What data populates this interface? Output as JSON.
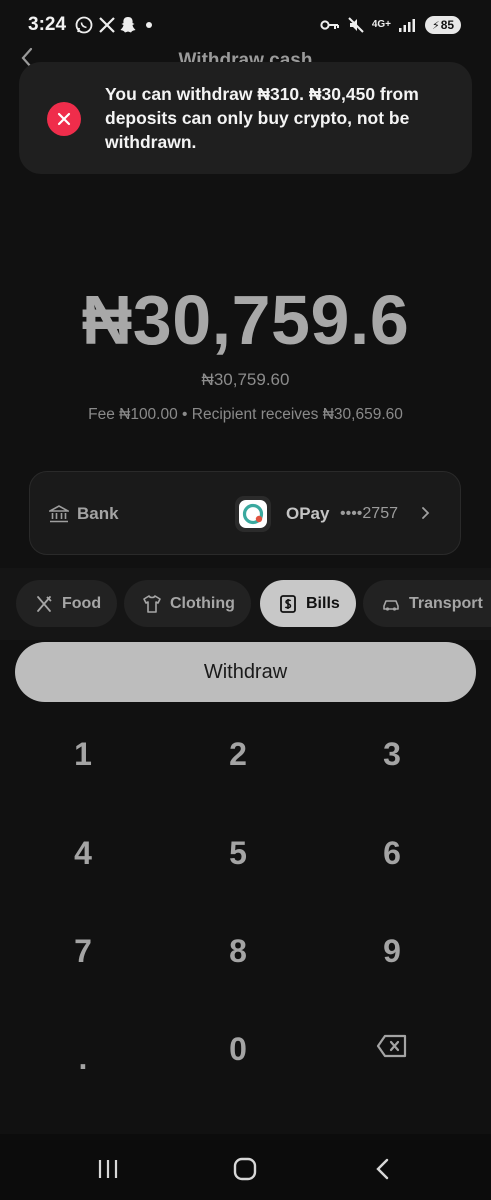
{
  "status": {
    "time": "3:24",
    "network": "4G+",
    "battery": "85"
  },
  "header": {
    "title": "Withdraw cash"
  },
  "toast": {
    "message": "You can withdraw ₦310. ₦30,450 from deposits can only buy crypto, not be withdrawn."
  },
  "amount": {
    "main": "₦30,759.6",
    "sub": "₦30,759.60",
    "fee_line": "Fee ₦100.00 • Recipient receives ₦30,659.60"
  },
  "bank": {
    "label": "Bank",
    "provider": "OPay",
    "account": "••••2757"
  },
  "chips": [
    {
      "label": "Food",
      "icon": "fork-knife-icon"
    },
    {
      "label": "Clothing",
      "icon": "shirt-icon"
    },
    {
      "label": "Bills",
      "icon": "dollar-bill-icon",
      "selected": true
    },
    {
      "label": "Transport",
      "icon": "car-icon"
    }
  ],
  "withdraw": {
    "label": "Withdraw"
  },
  "keypad": {
    "keys": [
      "1",
      "2",
      "3",
      "4",
      "5",
      "6",
      "7",
      "8",
      "9",
      ".",
      "0"
    ]
  },
  "colors": {
    "background": "#111111",
    "toast_icon": "#ef2d4b",
    "button": "#bdbdbd",
    "chip_active": "#c8c8c8"
  }
}
